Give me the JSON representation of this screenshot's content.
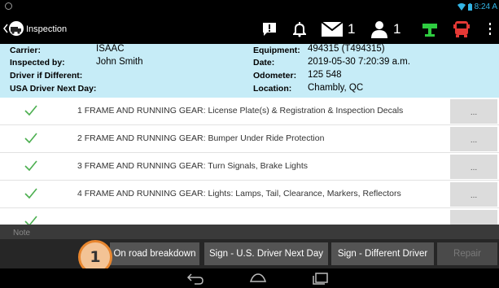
{
  "statusbar": {
    "time": "8:24 A"
  },
  "actionbar": {
    "title": "Inspection",
    "messages_count": "1",
    "users_count": "1"
  },
  "info": {
    "carrier_label": "Carrier:",
    "carrier_value": "ISAAC",
    "inspected_by_label": "Inspected by:",
    "inspected_by_value": "John Smith",
    "driver_if_different_label": "Driver if Different:",
    "usa_driver_label": "USA Driver Next Day:",
    "equipment_label": "Equipment:",
    "equipment_value": "494315 (T494315)",
    "date_label": "Date:",
    "date_value": "2019-05-30 7:20:39 a.m.",
    "odometer_label": "Odometer:",
    "odometer_value": "125 548",
    "location_label": "Location:",
    "location_value": "Chambly, QC"
  },
  "items": [
    {
      "text": "1 FRAME AND RUNNING GEAR: License Plate(s) & Registration & Inspection Decals",
      "more": "..."
    },
    {
      "text": "2 FRAME AND RUNNING GEAR: Bumper Under Ride Protection",
      "more": "..."
    },
    {
      "text": "3 FRAME AND RUNNING GEAR: Turn Signals, Brake Lights",
      "more": "..."
    },
    {
      "text": "4 FRAME AND RUNNING GEAR: Lights: Lamps, Tail, Clearance, Markers, Reflectors",
      "more": "..."
    }
  ],
  "note": {
    "placeholder": "Note"
  },
  "buttons": {
    "on_road_breakdown": "On road breakdown",
    "sign_us_driver": "Sign - U.S. Driver Next Day",
    "sign_different_driver": "Sign - Different Driver",
    "repair": "Repair"
  },
  "callout": {
    "number": "1"
  },
  "colors": {
    "accent": "#33b5e5",
    "info_bg": "#c6ecf7",
    "check": "#4caf50",
    "callout_fill": "#f3c395",
    "callout_border": "#e8862e",
    "truck_red": "#e53935",
    "green_icon": "#2ecc40"
  },
  "icons": [
    "alert-icon",
    "bell-icon",
    "mail-icon",
    "user-icon",
    "hookup-icon",
    "truck-icon",
    "overflow-menu-icon",
    "back-icon",
    "home-icon",
    "recent-apps-icon",
    "wifi-icon",
    "battery-icon",
    "check-icon"
  ]
}
